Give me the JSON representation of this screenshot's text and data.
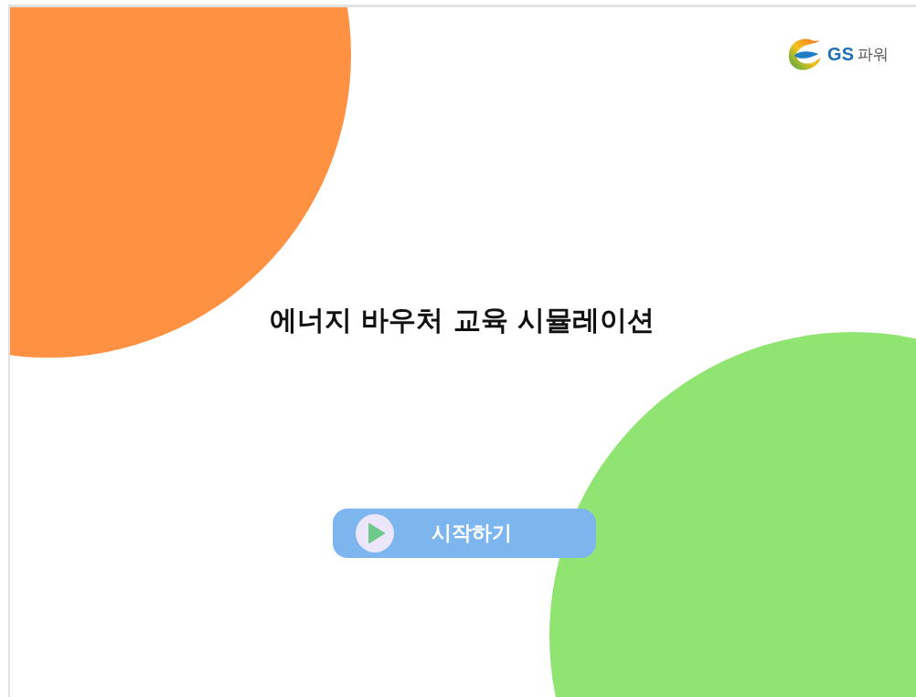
{
  "logo": {
    "brand": "GS",
    "name": "파워"
  },
  "title": "에너지 바우처 교육 시뮬레이션",
  "start_button": {
    "label": "시작하기"
  }
}
